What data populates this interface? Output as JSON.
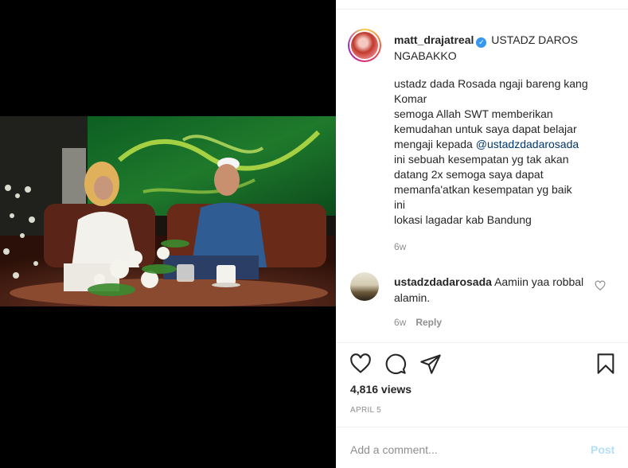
{
  "post": {
    "username": "matt_drajatreal",
    "verified_icon": "verified-badge-icon",
    "caption_title": "USTADZ DAROS NGABAKKO",
    "caption_lines": [
      "ustadz dada Rosada ngaji bareng kang",
      "Komar",
      "semoga Allah SWT memberikan",
      "kemudahan untuk saya dapat belajar",
      "mengaji kepada",
      "ini sebuah kesempatan yg tak akan",
      "datang 2x semoga saya dapat",
      "memanfa'atkan kesempatan yg baik",
      "ini",
      "lokasi lagadar kab Bandung"
    ],
    "mention": "@ustadzdadarosada",
    "time_ago": "6w"
  },
  "comment": {
    "username": "ustadzdadarosada",
    "text": "Aamiin yaa robbal alamin.",
    "time_ago": "6w",
    "reply_label": "Reply"
  },
  "actions": {
    "icons": [
      "heart-icon",
      "comment-icon",
      "share-icon",
      "bookmark-icon"
    ],
    "views": "4,816 views",
    "date": "APRIL 5"
  },
  "composer": {
    "placeholder": "Add a comment...",
    "post_label": "Post"
  },
  "colors": {
    "link": "#00376b",
    "muted": "#8e8e8e",
    "verified": "#3897f0",
    "post_disabled": "#b2dffc"
  }
}
